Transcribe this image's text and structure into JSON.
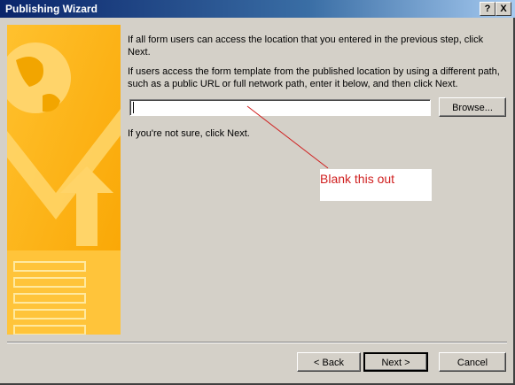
{
  "window": {
    "title": "Publishing Wizard",
    "help_glyph": "?",
    "close_glyph": "X"
  },
  "main": {
    "paragraph1": "If all form users can access the location that you entered in the previous step, click Next.",
    "paragraph2": "If users access the form template from the published location by using a different path, such as a public URL or full network path, enter it below, and then click Next.",
    "path_input_value": "",
    "browse_label": "Browse...",
    "hint": "If you're not sure, click Next."
  },
  "annotation": {
    "text": "Blank this out",
    "color": "#d01f1f"
  },
  "footer": {
    "back_label": "< Back",
    "next_label": "Next >",
    "cancel_label": "Cancel"
  }
}
